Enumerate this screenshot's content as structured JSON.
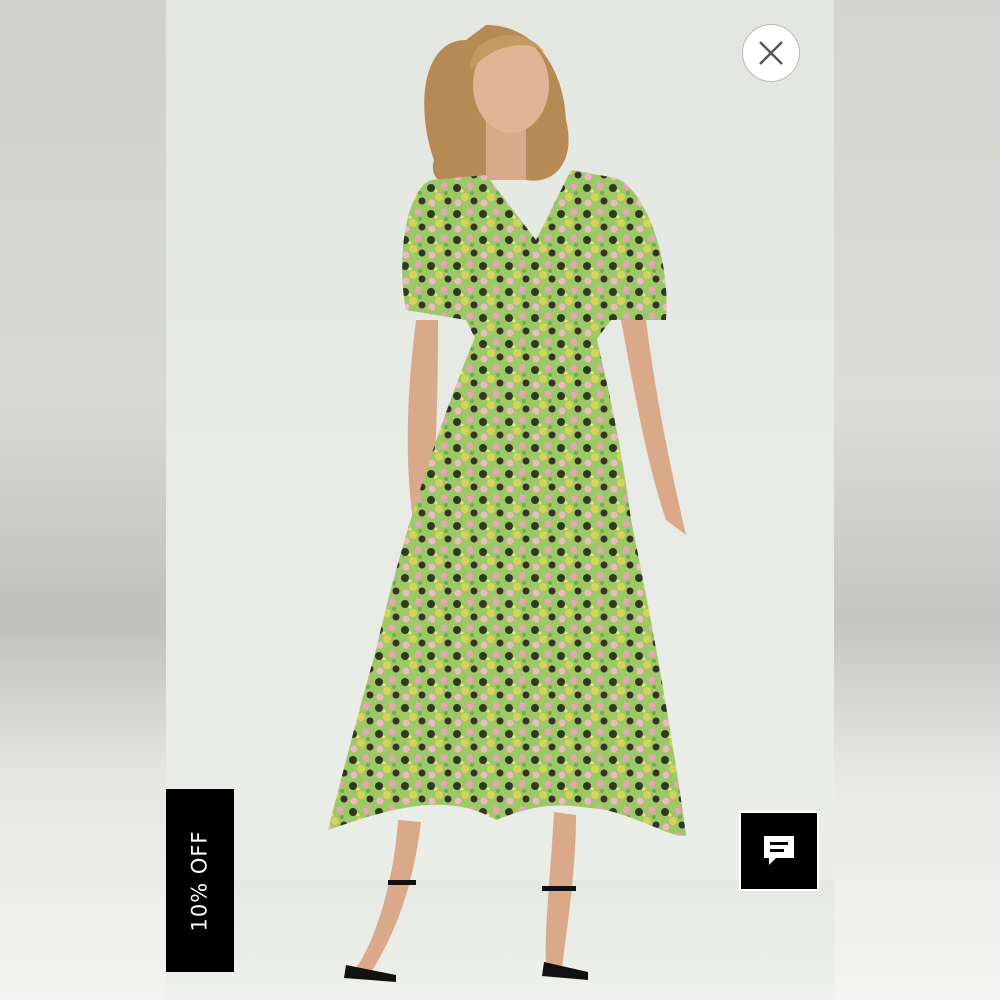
{
  "promo": {
    "label": "10% OFF"
  },
  "controls": {
    "close_icon": "close-icon",
    "chat_icon": "chat-bubble-icon"
  },
  "colors": {
    "promo_bg": "#000000",
    "chat_bg": "#000000",
    "close_bg": "#ffffff",
    "dress_green": "#8fbf5a",
    "dress_pink": "#e7a3b4"
  }
}
